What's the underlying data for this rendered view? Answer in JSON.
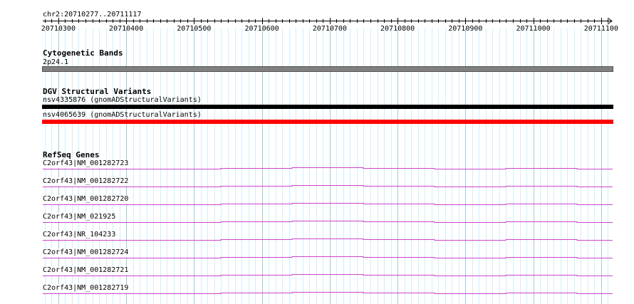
{
  "ruler": {
    "locus": "chr2:20710277..20711117",
    "tick_labels": [
      "20710300",
      "20710400",
      "20710500",
      "20710600",
      "20710700",
      "20710800",
      "20710900",
      "20711000",
      "20711100"
    ],
    "range_start": 20710277,
    "range_end": 20711117
  },
  "tracks": {
    "cytoband": {
      "title": "Cytogenetic Bands",
      "feature_label": "2p24.1",
      "color": "#808080"
    },
    "dgv": {
      "title": "DGV Structural Variants",
      "features": [
        {
          "label": "nsv4335876 (gnomADStructuralVariants)",
          "color": "#000000"
        },
        {
          "label": "nsv4065639 (gnomADStructuralVariants)",
          "color": "#ff0000"
        }
      ]
    },
    "refseq": {
      "title": "RefSeq Genes",
      "color": "#cc44cc",
      "genes": [
        {
          "label": "C2orf43|NM_001282723"
        },
        {
          "label": "C2orf43|NM_001282722"
        },
        {
          "label": "C2orf43|NM_001282720"
        },
        {
          "label": "C2orf43|NM_021925"
        },
        {
          "label": "C2orf43|NR_104233"
        },
        {
          "label": "C2orf43|NM_001282724"
        },
        {
          "label": "C2orf43|NM_001282721"
        },
        {
          "label": "C2orf43|NM_001282719"
        }
      ]
    }
  },
  "colors": {
    "grid_minor": "#ccefff",
    "grid_major": "#99ccdd"
  }
}
